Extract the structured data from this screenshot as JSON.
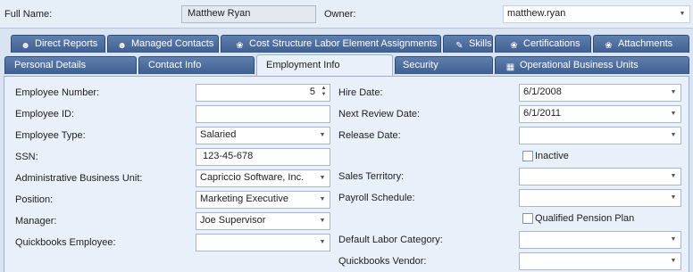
{
  "header": {
    "full_name_label": "Full Name:",
    "full_name_value": "Matthew Ryan",
    "owner_label": "Owner:",
    "owner_value": "matthew.ryan"
  },
  "tabs_row1": [
    {
      "label": "Direct Reports",
      "icon": "people-icon"
    },
    {
      "label": "Managed Contacts",
      "icon": "contacts-icon"
    },
    {
      "label": "Cost Structure Labor Element Assignments",
      "icon": "gear-icon"
    },
    {
      "label": "Skills",
      "icon": "tool-icon"
    },
    {
      "label": "Certifications",
      "icon": "gear-icon"
    },
    {
      "label": "Attachments",
      "icon": "gear-icon"
    }
  ],
  "tabs_row2": [
    {
      "label": "Personal Details"
    },
    {
      "label": "Contact Info"
    },
    {
      "label": "Employment Info",
      "active": true
    },
    {
      "label": "Security"
    },
    {
      "label": "Operational Business Units",
      "icon": "grid-icon"
    }
  ],
  "form": {
    "employee_number": {
      "label": "Employee Number:",
      "value": "5"
    },
    "employee_id": {
      "label": "Employee ID:",
      "value": ""
    },
    "employee_type": {
      "label": "Employee Type:",
      "value": "Salaried"
    },
    "ssn": {
      "label": "SSN:",
      "value": "123-45-678"
    },
    "admin_bu": {
      "label": "Administrative Business Unit:",
      "value": "Capriccio Software, Inc."
    },
    "position": {
      "label": "Position:",
      "value": "Marketing Executive"
    },
    "manager": {
      "label": "Manager:",
      "value": "Joe Supervisor"
    },
    "qb_employee": {
      "label": "Quickbooks Employee:",
      "value": ""
    },
    "hire_date": {
      "label": "Hire Date:",
      "value": "6/1/2008"
    },
    "next_review": {
      "label": "Next Review Date:",
      "value": "6/1/2011"
    },
    "release_date": {
      "label": "Release Date:",
      "value": ""
    },
    "inactive": {
      "label": "Inactive",
      "checked": false
    },
    "sales_territory": {
      "label": "Sales Territory:",
      "value": ""
    },
    "payroll_schedule": {
      "label": "Payroll Schedule:",
      "value": ""
    },
    "qualified_pension": {
      "label": "Qualified Pension Plan",
      "checked": false
    },
    "default_labor": {
      "label": "Default Labor Category:",
      "value": ""
    },
    "qb_vendor": {
      "label": "Quickbooks Vendor:",
      "value": ""
    }
  }
}
